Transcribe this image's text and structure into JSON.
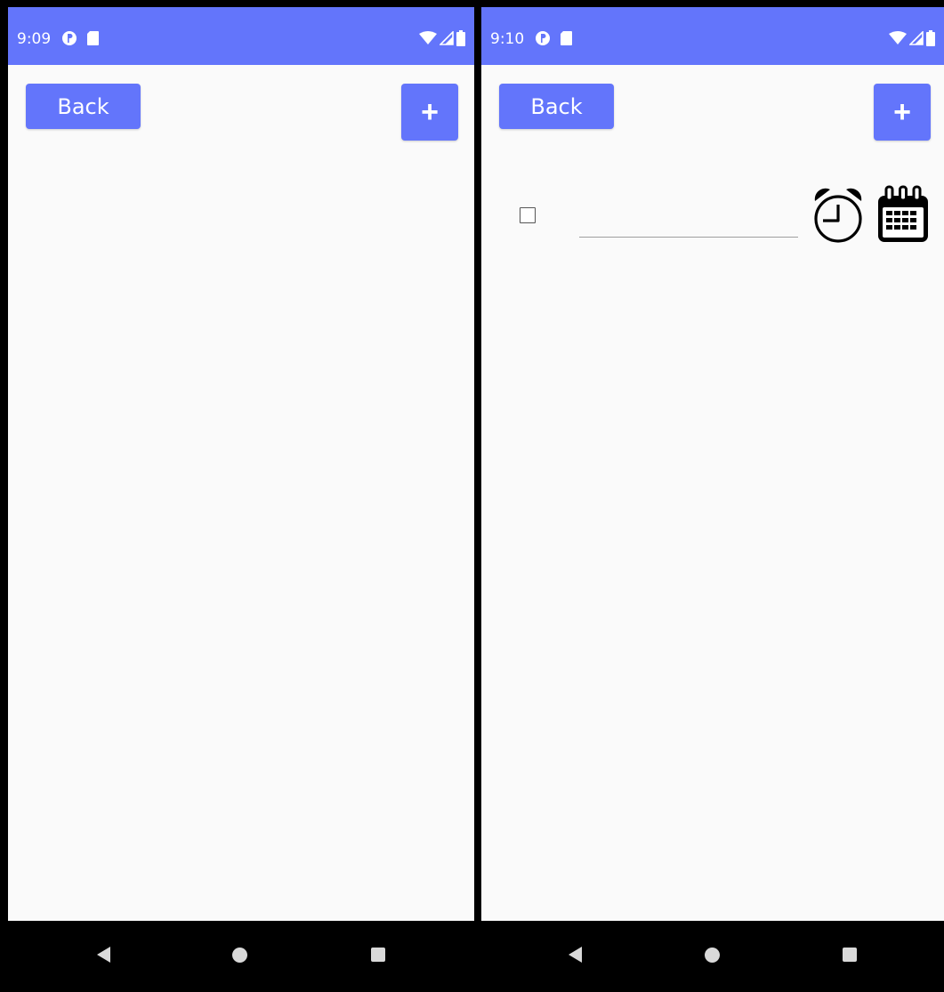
{
  "screens": [
    {
      "status": {
        "time": "9:09"
      },
      "toolbar": {
        "back_label": "Back",
        "add_label": "+"
      }
    },
    {
      "status": {
        "time": "9:10"
      },
      "toolbar": {
        "back_label": "Back",
        "add_label": "+"
      },
      "task": {
        "text": "",
        "checked": false
      }
    }
  ],
  "colors": {
    "accent": "#6375fb",
    "background": "#fafafa",
    "navbar": "#000000"
  },
  "icons": {
    "status": [
      "app-notification-icon",
      "sd-card-icon",
      "wifi-icon",
      "signal-icon",
      "battery-icon"
    ],
    "row": [
      "checkbox",
      "alarm-clock-icon",
      "calendar-icon"
    ],
    "nav": [
      "nav-back-icon",
      "nav-home-icon",
      "nav-recents-icon"
    ]
  }
}
